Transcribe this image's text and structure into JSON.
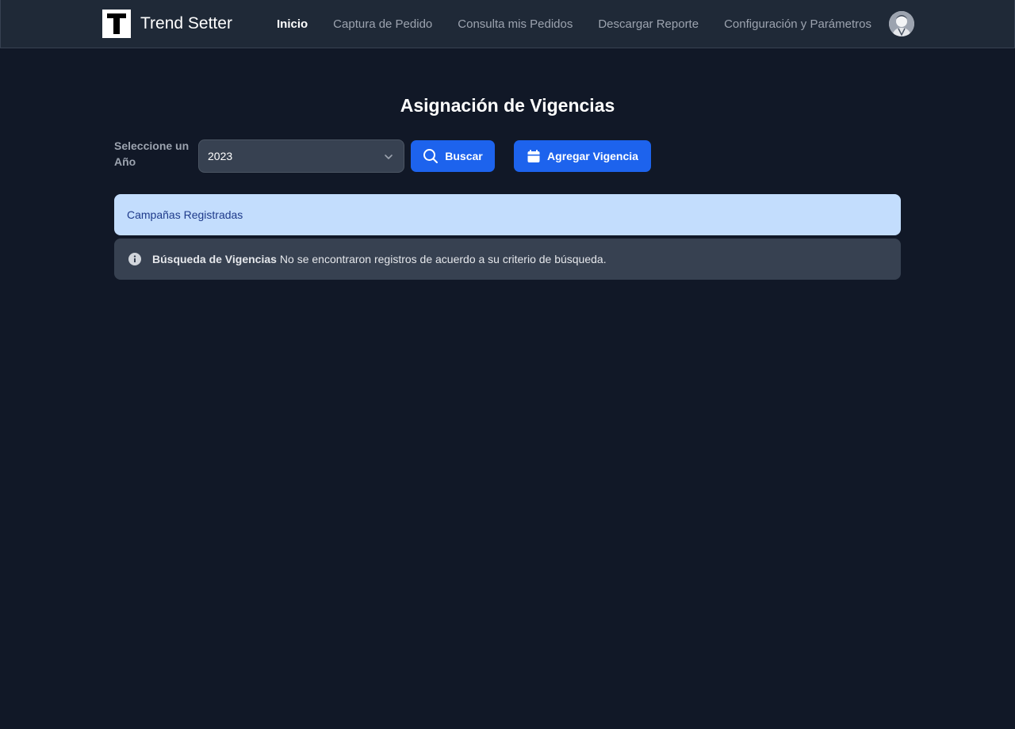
{
  "brand": {
    "logo_letter": "T",
    "name": "Trend Setter"
  },
  "nav": {
    "items": [
      {
        "label": "Inicio",
        "active": true
      },
      {
        "label": "Captura de Pedido",
        "active": false
      },
      {
        "label": "Consulta mis Pedidos",
        "active": false
      },
      {
        "label": "Descargar Reporte",
        "active": false
      },
      {
        "label": "Configuración y Parámetros",
        "active": false
      }
    ],
    "avatar_icon": "user-avatar"
  },
  "main": {
    "title": "Asignación de Vigencias",
    "year_label": "Seleccione un Año",
    "year_value": "2023",
    "search_button": "Buscar",
    "search_icon": "search-icon",
    "add_button": "Agregar Vigencia",
    "add_icon": "calendar-icon",
    "campaigns_header": "Campañas Registradas",
    "alert": {
      "icon": "info-icon",
      "title": "Búsqueda de Vigencias",
      "message": "No se encontraron registros de acuerdo a su criterio de búsqueda."
    }
  },
  "colors": {
    "page_background": "#111827",
    "navbar_background": "#1f2937",
    "primary_button": "#1d63ed",
    "campaign_bar": "#c3ddfd",
    "alert_background": "#374151"
  }
}
